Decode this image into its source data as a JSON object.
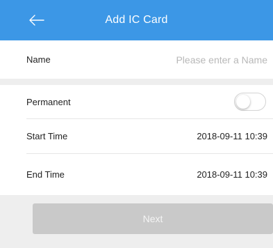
{
  "header": {
    "title": "Add IC Card",
    "back_icon": "back-arrow-icon",
    "background": "#3c97e6"
  },
  "form": {
    "name": {
      "label": "Name",
      "placeholder": "Please enter a Name",
      "value": ""
    },
    "permanent": {
      "label": "Permanent",
      "enabled": false
    },
    "start_time": {
      "label": "Start Time",
      "value": "2018-09-11 10:39"
    },
    "end_time": {
      "label": "End Time",
      "value": "2018-09-11 10:39"
    }
  },
  "footer": {
    "next_label": "Next",
    "next_enabled": false
  }
}
